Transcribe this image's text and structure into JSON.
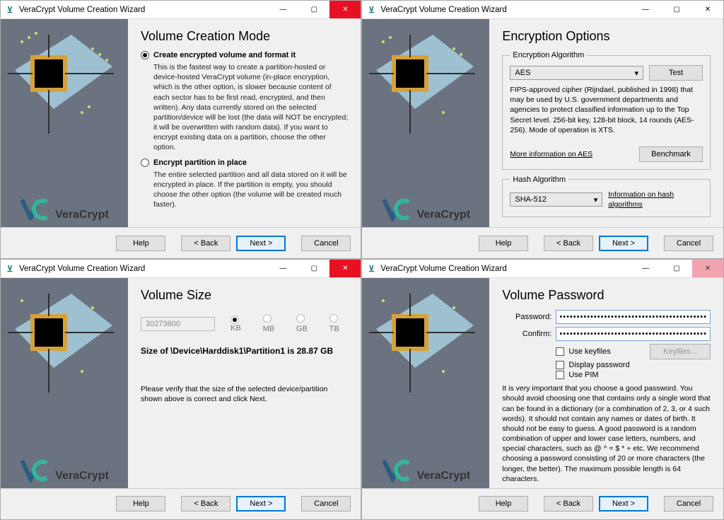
{
  "window_title": "VeraCrypt Volume Creation Wizard",
  "brand": "VeraCrypt",
  "buttons": {
    "help": "Help",
    "back": "< Back",
    "next": "Next >",
    "cancel": "Cancel",
    "test": "Test",
    "benchmark": "Benchmark",
    "keyfiles": "Keyfiles..."
  },
  "p1": {
    "title": "Volume Creation Mode",
    "opt1_label": "Create encrypted volume and format it",
    "opt1_desc": "This is the fastest way to create a partition-hosted or device-hosted VeraCrypt volume (in-place encryption, which is the other option, is slower because content of each sector has to be first read, encrypted, and then written). Any data currently stored on the selected partition/device will be lost (the data will NOT be encrypted; it will be overwritten with random data). If you want to encrypt existing data on a partition, choose the other option.",
    "opt2_label": "Encrypt partition in place",
    "opt2_desc": "The entire selected partition and all data stored on it will be encrypted in place. If the partition is empty, you should choose the other option (the volume will be created much faster)."
  },
  "p2": {
    "title": "Encryption Options",
    "enc_legend": "Encryption Algorithm",
    "enc_value": "AES",
    "enc_desc": "FIPS-approved cipher (Rijndael, published in 1998) that may be used by U.S. government departments and agencies to protect classified information up to the Top Secret level. 256-bit key, 128-bit block, 14 rounds (AES-256). Mode of operation is XTS.",
    "enc_more": "More information on AES",
    "hash_legend": "Hash Algorithm",
    "hash_value": "SHA-512",
    "hash_info": "Information on hash algorithms"
  },
  "p3": {
    "title": "Volume Size",
    "size_value": "30273600",
    "units": {
      "kb": "KB",
      "mb": "MB",
      "gb": "GB",
      "tb": "TB"
    },
    "size_line": "Size of \\Device\\Harddisk1\\Partition1 is 28.87 GB",
    "verify": "Please verify that the size of the selected device/partition shown above is correct and click Next."
  },
  "p4": {
    "title": "Volume Password",
    "pw_label": "Password:",
    "confirm_label": "Confirm:",
    "pw_mask": "•••••••••••••••••••••••••••••••••••••••••••",
    "use_keyfiles": "Use keyfiles",
    "display_pw": "Display password",
    "use_pim": "Use PIM",
    "advice": "It is very important that you choose a good password. You should avoid choosing one that contains only a single word that can be found in a dictionary (or a combination of 2, 3, or 4 such words). It should not contain any names or dates of birth. It should not be easy to guess. A good password is a random combination of upper and lower case letters, numbers, and special characters, such as @ ^ = $ * + etc. We recommend choosing a password consisting of 20 or more characters (the longer, the better). The maximum possible length is 64 characters."
  }
}
